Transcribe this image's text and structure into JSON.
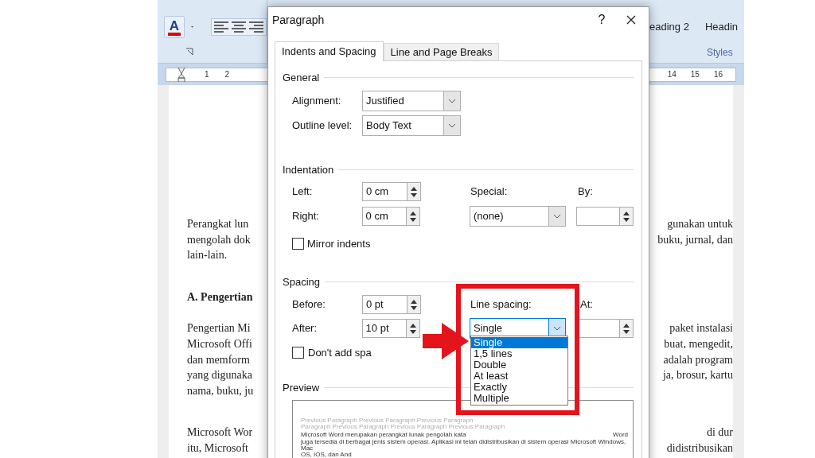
{
  "ribbon": {
    "font_color": {
      "letter": "A"
    },
    "style_names": [
      "eading 2",
      "Headin"
    ],
    "group_label": "Styles"
  },
  "ruler": {
    "left_numbers": [
      "1",
      "2"
    ],
    "right_numbers": [
      "14",
      "15",
      "16"
    ]
  },
  "document": {
    "paragraphs": [
      {
        "kind": "body",
        "lines": [
          {
            "left": "Perangkat lun",
            "right": "gunakan untuk"
          },
          {
            "left": "mengolah dok",
            "right": "buku, jurnal, dan"
          },
          {
            "left": "lain-lain."
          }
        ]
      },
      {
        "kind": "heading",
        "lines": [
          {
            "left": "A. Pengertian"
          }
        ]
      },
      {
        "kind": "body",
        "lines": [
          {
            "left": "Pengertian Mi",
            "right": "paket instalasi"
          },
          {
            "left": "Microsoft Offi",
            "right": "buat, mengedit,"
          },
          {
            "left": "dan memform",
            "right": "adalah program"
          },
          {
            "left": "yang digunaka",
            "right": "ja, brosur, kartu"
          },
          {
            "left": "nama, buku, ju"
          }
        ]
      },
      {
        "kind": "body",
        "lines": [
          {
            "left": "Microsoft Wor",
            "right": "di dur"
          },
          {
            "left": "itu, Microsoft",
            "right": "didistribusikan"
          }
        ]
      }
    ]
  },
  "dialog": {
    "title": "Paragraph",
    "help": "?",
    "tabs": [
      {
        "label": "Indents and Spacing",
        "selected": true
      },
      {
        "label": "Line and Page Breaks",
        "selected": false
      }
    ],
    "general": {
      "title": "General",
      "alignment": {
        "label": "Alignment:",
        "value": "Justified"
      },
      "outline_level": {
        "label": "Outline level:",
        "value": "Body Text"
      }
    },
    "indentation": {
      "title": "Indentation",
      "left": {
        "label": "Left:",
        "value": "0 cm"
      },
      "right": {
        "label": "Right:",
        "value": "0 cm"
      },
      "special": {
        "label": "Special:",
        "value": "(none)"
      },
      "by": {
        "label": "By:"
      },
      "mirror_indents": {
        "label": "Mirror indents",
        "checked": false
      }
    },
    "spacing": {
      "title": "Spacing",
      "before": {
        "label": "Before:",
        "value": "0 pt"
      },
      "after": {
        "label": "After:",
        "value": "10 pt"
      },
      "line_spacing": {
        "label": "Line spacing:",
        "value": "Single",
        "expanded": true,
        "options": [
          {
            "label": "Single",
            "selected": true
          },
          {
            "label": "1,5 lines",
            "selected": false
          },
          {
            "label": "Double",
            "selected": false
          },
          {
            "label": "At least",
            "selected": false
          },
          {
            "label": "Exactly",
            "selected": false
          },
          {
            "label": "Multiple",
            "selected": false
          }
        ]
      },
      "at": {
        "label": "At:"
      },
      "dont_add_space": {
        "label": "Don't add spa",
        "checked": false
      }
    },
    "preview": {
      "title": "Preview",
      "previous_lines": [
        "Previous Paragraph Previous Paragraph Previous Paragraph",
        "Paragraph Previous Paragraph Previous Paragraph Previous Paragraph"
      ],
      "sample_lines": [
        {
          "left": "Microsoft Word merupakan perangkat lunak pengolah kata",
          "right": "Word"
        },
        {
          "left": "juga tersedia di berbagai jenis sistem operasi. Aplikasi ini telah didistribusikan di sistem operasi Microsoft Windows, Mac"
        },
        {
          "left": "OS, IOS, dan And"
        }
      ]
    }
  },
  "annotation": {
    "highlight_box": true,
    "arrow": true
  }
}
